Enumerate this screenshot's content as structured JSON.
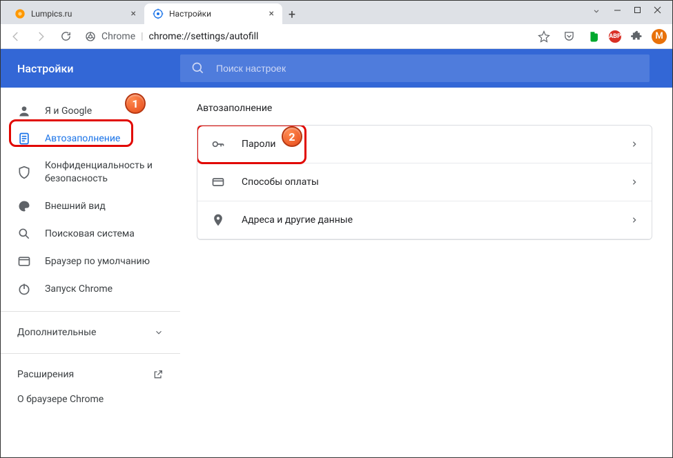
{
  "tabs": [
    {
      "title": "Lumpics.ru",
      "active": false
    },
    {
      "title": "Настройки",
      "active": true
    }
  ],
  "addressbar": {
    "scheme_label": "Chrome",
    "url": "chrome://settings/autofill"
  },
  "profile_initial": "M",
  "header": {
    "title": "Настройки",
    "search_placeholder": "Поиск настроек"
  },
  "sidebar": {
    "items": [
      {
        "label": "Я и Google"
      },
      {
        "label": "Автозаполнение"
      },
      {
        "label": "Конфиденциальность и безопасность"
      },
      {
        "label": "Внешний вид"
      },
      {
        "label": "Поисковая система"
      },
      {
        "label": "Браузер по умолчанию"
      },
      {
        "label": "Запуск Chrome"
      }
    ],
    "advanced_label": "Дополнительные",
    "extensions_label": "Расширения",
    "about_label": "О браузере Chrome"
  },
  "content": {
    "section_title": "Автозаполнение",
    "rows": [
      {
        "label": "Пароли"
      },
      {
        "label": "Способы оплаты"
      },
      {
        "label": "Адреса и другие данные"
      }
    ]
  },
  "annotations": {
    "badge1": "1",
    "badge2": "2"
  },
  "ext_abp": "ABP"
}
